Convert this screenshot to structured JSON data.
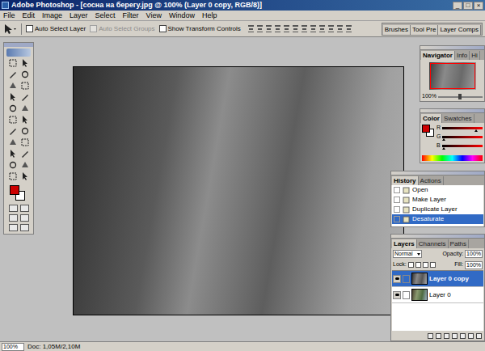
{
  "window": {
    "title": "Adobe Photoshop - [сосна на берегу.jpg @ 100% (Layer 0 copy, RGB/8)]",
    "controls": [
      "_",
      "□",
      "×"
    ]
  },
  "menu": [
    "File",
    "Edit",
    "Image",
    "Layer",
    "Select",
    "Filter",
    "View",
    "Window",
    "Help"
  ],
  "options": [
    {
      "label": "Auto Select Layer",
      "checked": false,
      "disabled": false
    },
    {
      "label": "Auto Select Groups",
      "checked": false,
      "disabled": true
    },
    {
      "label": "Show Transform Controls",
      "checked": false,
      "disabled": false
    }
  ],
  "palette_well": [
    "Brushes",
    "Tool Pre",
    "Layer Comps"
  ],
  "toolbox": {
    "foreground": "#cc0000",
    "background": "#ffffff"
  },
  "navigator": {
    "tabs": [
      {
        "label": "Navigator",
        "selected": true
      },
      {
        "label": "Info",
        "selected": false
      },
      {
        "label": "Hi",
        "selected": false
      }
    ],
    "zoom": "100%",
    "level": 0.45
  },
  "color": {
    "tabs": [
      {
        "label": "Color",
        "selected": true
      },
      {
        "label": "Swatches",
        "selected": false
      }
    ],
    "foreground": "#cc0000",
    "background": "#ffffff",
    "channels": [
      {
        "name": "R",
        "level": 0.8
      },
      {
        "name": "G",
        "level": 0.0
      },
      {
        "name": "B",
        "level": 0.0
      }
    ]
  },
  "history": {
    "tabs": [
      {
        "label": "History",
        "selected": true
      },
      {
        "label": "Actions",
        "selected": false
      }
    ],
    "items": [
      {
        "label": "Open",
        "selected": false
      },
      {
        "label": "Make Layer",
        "selected": false
      },
      {
        "label": "Duplicate Layer",
        "selected": false
      },
      {
        "label": "Desaturate",
        "selected": true
      }
    ]
  },
  "layers": {
    "tabs": [
      {
        "label": "Layers",
        "selected": true
      },
      {
        "label": "Channels",
        "selected": false
      },
      {
        "label": "Paths",
        "selected": false
      }
    ],
    "blend": "Normal",
    "opacity_label": "Opacity:",
    "opacity": "100%",
    "lock_label": "Lock:",
    "fill_label": "Fill:",
    "fill": "100%",
    "items": [
      {
        "name": "Layer 0 copy",
        "selected": true,
        "visible": true,
        "desaturated": true
      },
      {
        "name": "Layer 0",
        "selected": false,
        "visible": true,
        "desaturated": false
      }
    ]
  },
  "status_bar": {
    "zoom": "100%",
    "doc": "Doc: 1,05M/2,10M"
  }
}
